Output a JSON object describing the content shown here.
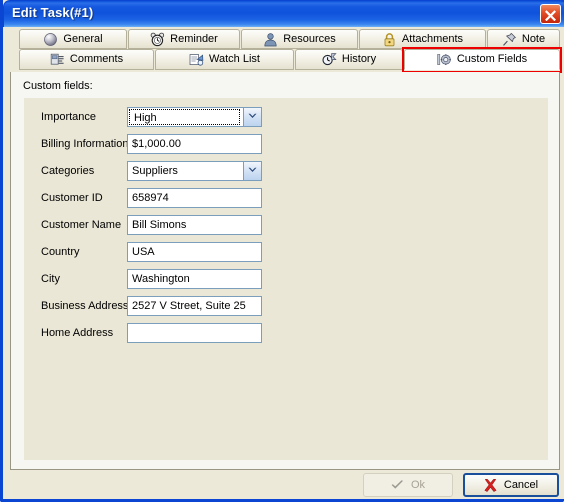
{
  "window": {
    "title": "Edit Task(#1)",
    "close_icon": "close-icon",
    "accent_titlebar": "#0f52dc",
    "panel_color": "#eae7d8",
    "highlight_color": "#ee0000"
  },
  "tabs": {
    "row1": [
      {
        "label": "General",
        "icon": "sphere-icon"
      },
      {
        "label": "Reminder",
        "icon": "alarm-clock-icon"
      },
      {
        "label": "Resources",
        "icon": "person-icon"
      },
      {
        "label": "Attachments",
        "icon": "padlock-icon"
      },
      {
        "label": "Note",
        "icon": "pushpin-icon"
      }
    ],
    "row2": [
      {
        "label": "Comments",
        "icon": "comments-icon"
      },
      {
        "label": "Watch List",
        "icon": "watch-list-icon"
      },
      {
        "label": "History",
        "icon": "clock-history-icon"
      },
      {
        "label": "Custom Fields",
        "icon": "gear-icon",
        "active": true
      }
    ]
  },
  "page": {
    "section_title": "Custom fields:",
    "fields": [
      {
        "label": "Importance",
        "type": "combo",
        "value": "High",
        "focused": true
      },
      {
        "label": "Billing Information",
        "type": "text",
        "value": "$1,000.00"
      },
      {
        "label": "Categories",
        "type": "combo",
        "value": "Suppliers"
      },
      {
        "label": "Customer ID",
        "type": "text",
        "value": "658974"
      },
      {
        "label": "Customer Name",
        "type": "text",
        "value": "Bill Simons"
      },
      {
        "label": "Country",
        "type": "text",
        "value": "USA"
      },
      {
        "label": "City",
        "type": "text",
        "value": "Washington"
      },
      {
        "label": "Business Address",
        "type": "text",
        "value": "2527 V Street, Suite 25"
      },
      {
        "label": "Home Address",
        "type": "text",
        "value": ""
      }
    ]
  },
  "footer": {
    "ok_label": "Ok",
    "ok_icon": "checkmark-icon",
    "ok_enabled": false,
    "cancel_label": "Cancel",
    "cancel_icon": "red-x-icon"
  }
}
